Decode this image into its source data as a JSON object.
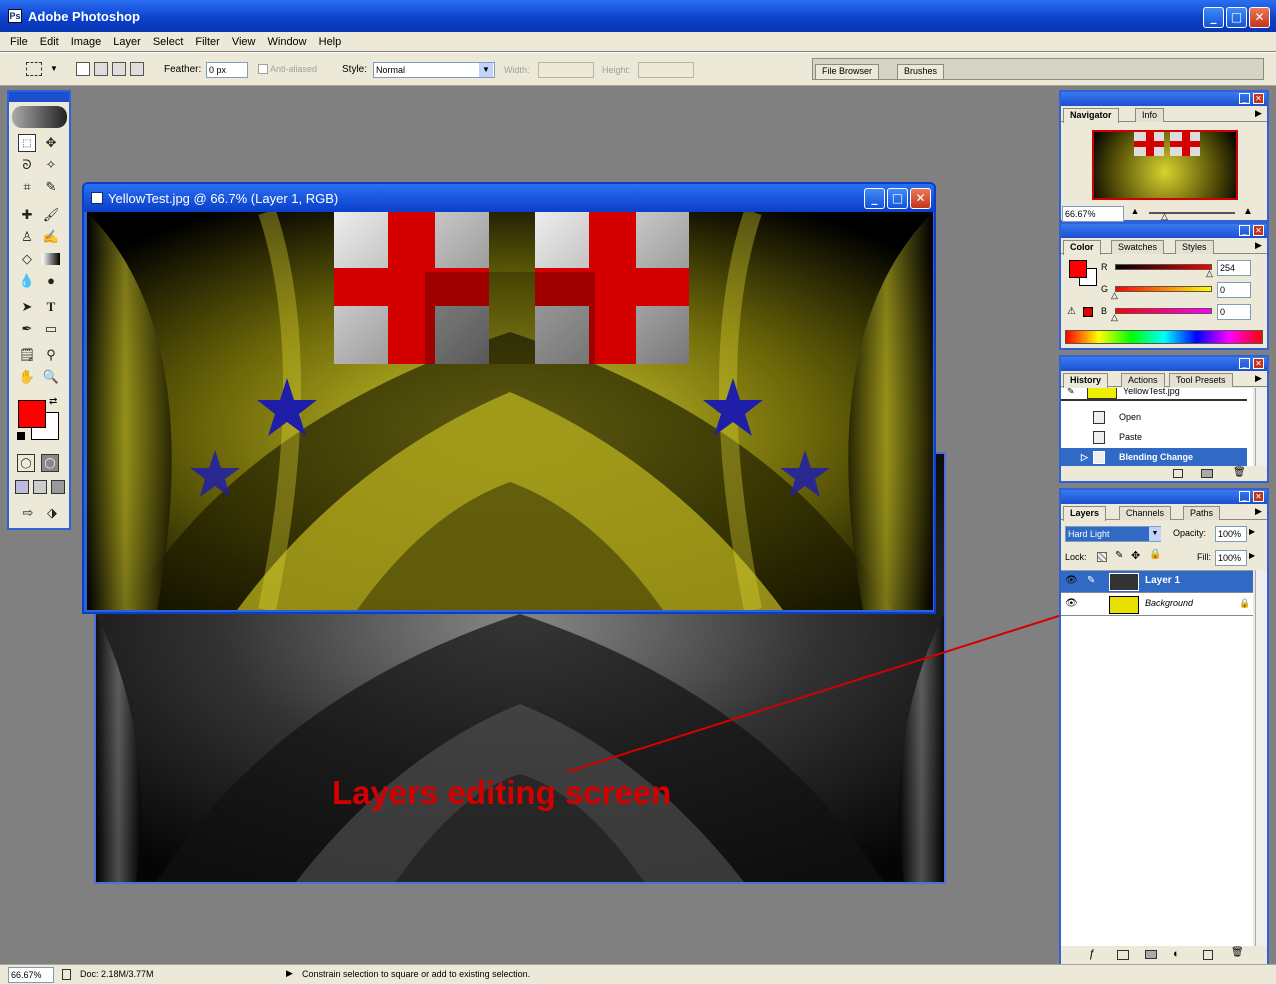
{
  "app": {
    "title": "Adobe Photoshop"
  },
  "menu": [
    "File",
    "Edit",
    "Image",
    "Layer",
    "Select",
    "Filter",
    "View",
    "Window",
    "Help"
  ],
  "options": {
    "feather_label": "Feather:",
    "feather_value": "0 px",
    "antialias_label": "Anti-aliased",
    "style_label": "Style:",
    "style_value": "Normal",
    "width_label": "Width:",
    "height_label": "Height:"
  },
  "palette_well": {
    "tabs": [
      "File Browser",
      "Brushes"
    ]
  },
  "document": {
    "title": "YellowTest.jpg @ 66.7% (Layer 1, RGB)"
  },
  "annotation": {
    "text": "Layers editing screen",
    "color": "#d40000"
  },
  "navigator": {
    "tabs": [
      "Navigator",
      "Info"
    ],
    "zoom": "66.67%"
  },
  "color": {
    "tabs": [
      "Color",
      "Swatches",
      "Styles"
    ],
    "r_label": "R",
    "g_label": "G",
    "b_label": "B",
    "r": "254",
    "g": "0",
    "b": "0",
    "foreground": "#fe0000"
  },
  "history": {
    "tabs": [
      "History",
      "Actions",
      "Tool Presets"
    ],
    "snapshot": "YellowTest.jpg",
    "items": [
      "Open",
      "Paste",
      "Blending Change"
    ],
    "active_index": 2
  },
  "layers": {
    "tabs": [
      "Layers",
      "Channels",
      "Paths"
    ],
    "blend_mode": "Hard Light",
    "opacity_label": "Opacity:",
    "opacity": "100%",
    "lock_label": "Lock:",
    "fill_label": "Fill:",
    "fill": "100%",
    "items": [
      "Layer 1",
      "Background"
    ],
    "active_index": 0
  },
  "status": {
    "zoom": "66.67%",
    "doc": "Doc: 2.18M/3.77M",
    "hint": "Constrain selection to square or add to existing selection."
  },
  "colors": {
    "xp_blue": "#1c4fd0",
    "highlight": "#316ac5"
  }
}
